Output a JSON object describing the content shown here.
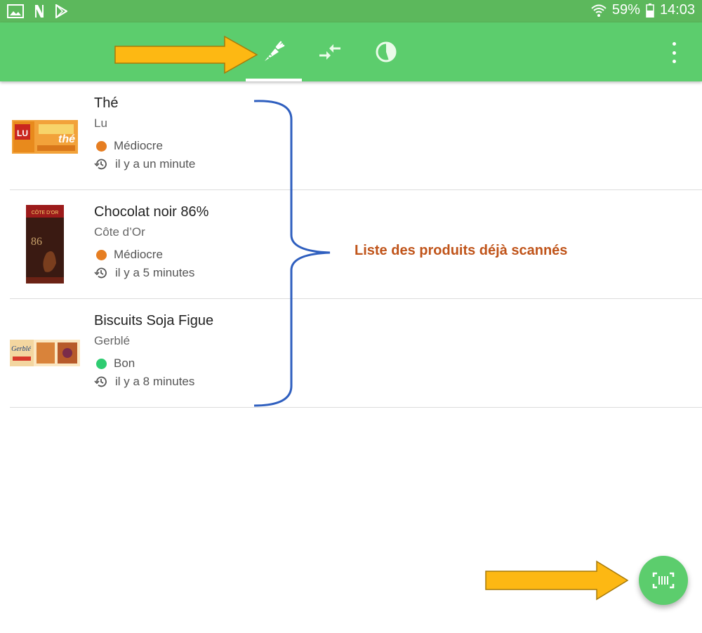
{
  "status_bar": {
    "battery": "59%",
    "time": "14:03",
    "icons": [
      "image-icon",
      "n-app-icon",
      "play-store-icon",
      "wifi-icon",
      "battery-icon"
    ]
  },
  "toolbar": {
    "tabs": [
      {
        "name": "history-tab",
        "icon": "carrot-icon",
        "selected": true
      },
      {
        "name": "compare-tab",
        "icon": "compare-arrows-icon",
        "selected": false
      },
      {
        "name": "stats-tab",
        "icon": "pie-chart-icon",
        "selected": false
      }
    ],
    "menu_icon": "more-vert-icon"
  },
  "products": [
    {
      "name": "Thé",
      "brand": "Lu",
      "score": "Médiocre",
      "score_color": "#e67e22",
      "time": "il y a un minute"
    },
    {
      "name": "Chocolat noir 86%",
      "brand": "Côte d’Or",
      "score": "Médiocre",
      "score_color": "#e67e22",
      "time": "il y a 5 minutes"
    },
    {
      "name": "Biscuits Soja Figue",
      "brand": "Gerblé",
      "score": "Bon",
      "score_color": "#2ecc71",
      "time": "il y a 8 minutes"
    }
  ],
  "packaging_text": {
    "lu_logo": "LU",
    "lu_the": "thé",
    "cotedor_brand": "CÔTE D’OR",
    "cotedor_86": "86",
    "gerble_brand": "Gerblé"
  },
  "annotation": {
    "text": "Liste des produits déjà scannés",
    "color": "#c0541a"
  },
  "fab": {
    "icon": "barcode-scan-icon"
  },
  "colors": {
    "primary": "#5ccd6d",
    "status_bar": "#5cb85c",
    "arrow": "#fdb813",
    "bracket": "#2f5fbf"
  }
}
